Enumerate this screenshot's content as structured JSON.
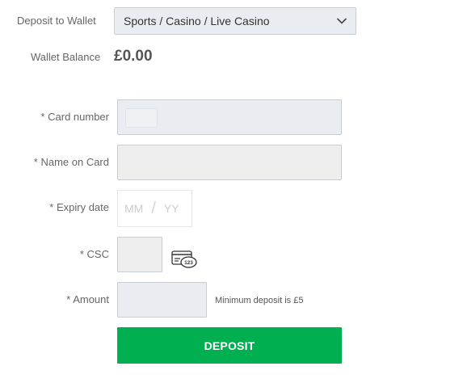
{
  "wallet": {
    "label": "Deposit to Wallet",
    "selected": "Sports / Casino / Live Casino",
    "balance_label": "Wallet Balance",
    "balance_value": "£0.00"
  },
  "form": {
    "card_number_label": "* Card number",
    "name_on_card_label": "* Name on Card",
    "expiry_label": "* Expiry date",
    "expiry_month_placeholder": "MM",
    "expiry_separator": "/",
    "expiry_year_placeholder": "YY",
    "csc_label": "* CSC",
    "amount_label": "* Amount",
    "amount_hint": "Minimum deposit is £5",
    "submit_label": "DEPOSIT"
  },
  "icons": {
    "dropdown": "chevron-down-icon",
    "card_chip": "card-placeholder-icon",
    "csc": "csc-card-icon"
  },
  "colors": {
    "primary_button": "#00b050",
    "input_background": "#e9ecf1",
    "text": "#555555"
  }
}
